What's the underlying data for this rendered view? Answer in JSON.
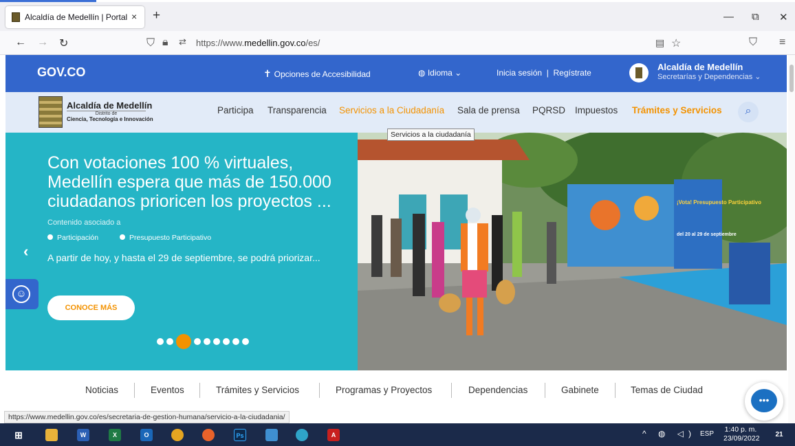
{
  "browser": {
    "tab_title": "Alcaldía de Medellín | Portal ins",
    "tab_close": "×",
    "new_tab": "+",
    "url_prefix": "https://www.",
    "url_domain": "medellin.gov.co",
    "url_path": "/es/",
    "status_url": "https://www.medellin.gov.co/es/secretaria-de-gestion-humana/servicio-a-la-ciudadania/"
  },
  "gov_bar": {
    "logo": "GOV.CO",
    "accessibility": "Opciones de Accesibilidad",
    "language": "Idioma",
    "login": "Inicia sesión  |  Regístrate",
    "entity_name": "Alcaldía de Medellín",
    "entity_sub": "Secretarías y Dependencias"
  },
  "site_header": {
    "name": "Alcaldía de Medellín",
    "sub1": "Distrito de",
    "sub2": "Ciencia, Tecnología e Innovación",
    "menu": [
      "Participa",
      "Transparencia",
      "Servicios a la Ciudadanía",
      "Sala de prensa",
      "PQRSD",
      "Impuestos",
      "Trámites y Servicios"
    ]
  },
  "tooltip": "Servicios a la ciudadanía",
  "hero": {
    "title": "Con votaciones 100 % virtuales, Medellín espera que más de 150.000 ciudadanos prioricen los proyectos ...",
    "assoc_label": "Contenido asociado a",
    "tags": [
      "Participación",
      "Presupuesto Participativo"
    ],
    "description": "A partir de hoy, y hasta el 29 de septiembre, se podrá priorizar...",
    "cta": "CONOCE MÁS",
    "slide_count": 9,
    "active_slide": 3,
    "poster_title": "¡Vota! Presupuesto Participativo",
    "poster_dates": "del 20 al 29 de septiembre"
  },
  "lower_nav": [
    "Noticias",
    "Eventos",
    "Trámites y Servicios",
    "Programas y Proyectos",
    "Dependencias",
    "Gabinete",
    "Temas de Ciudad"
  ],
  "taskbar": {
    "time": "1:40 p. m.",
    "date": "23/09/2022",
    "lang": "ESP",
    "notifications": "21"
  },
  "colors": {
    "gov_blue": "#3366cc",
    "accent_orange": "#f39200",
    "hero_teal": "#25b5c6"
  }
}
